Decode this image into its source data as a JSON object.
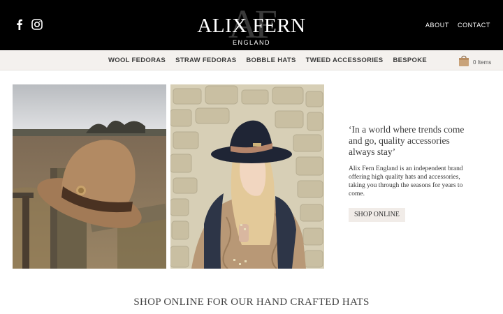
{
  "header": {
    "logo_monogram": "AF",
    "logo_name": "ALIX FERN",
    "logo_sub": "ENGLAND",
    "social_icons": [
      "facebook-icon",
      "instagram-icon"
    ],
    "links": [
      "ABOUT",
      "CONTACT"
    ]
  },
  "nav": {
    "items": [
      "WOOL FEDORAS",
      "STRAW FEDORAS",
      "BOBBLE HATS",
      "TWEED ACCESSORIES",
      "BESPOKE"
    ],
    "cart_count": "0 Items",
    "cart_icon": "shopping-bag-icon"
  },
  "hero": {
    "quote": "‘In a world where trends come and go, quality accessories always stay’",
    "description": "Alix Fern England is an independent brand offering high quality hats and accessories, taking you through the seasons for years to come.",
    "button": "SHOP ONLINE"
  },
  "section": {
    "heading": "SHOP ONLINE FOR OUR HAND CRAFTED HATS"
  },
  "colors": {
    "header_bg": "#000000",
    "nav_bg": "#f4f1ee",
    "button_bg": "#f1ece8"
  }
}
